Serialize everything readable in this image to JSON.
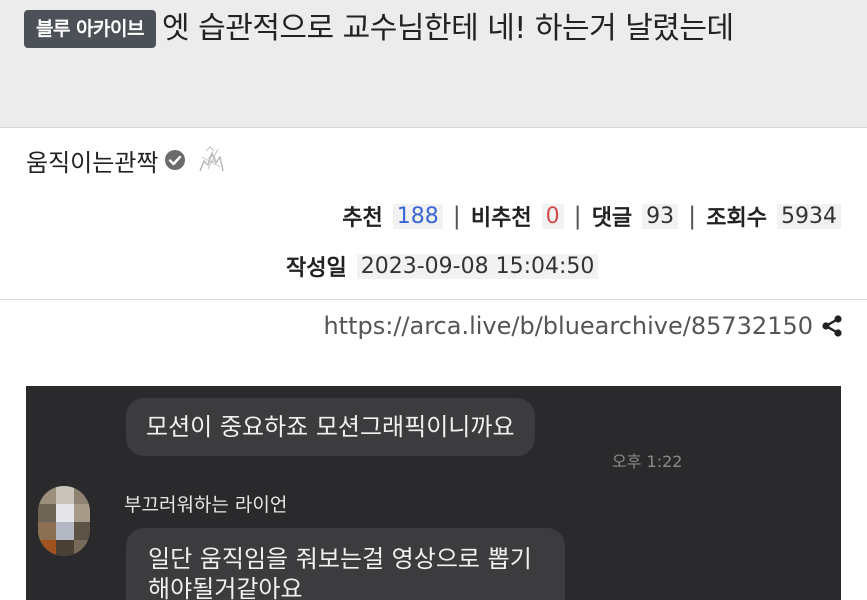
{
  "post": {
    "badge": "블루 아카이브",
    "title": "엣 습관적으로 교수님한테 네! 하는거 날렸는데",
    "author": "움직이는관짝",
    "stats": [
      {
        "label": "추천",
        "value": "188",
        "color": "#3a66d6"
      },
      {
        "label": "비추천",
        "value": "0",
        "color": "#d24b4b"
      },
      {
        "label": "댓글",
        "value": "93",
        "color": "#333333"
      },
      {
        "label": "조회수",
        "value": "5934",
        "color": "#333333"
      }
    ],
    "date_label": "작성일",
    "date_value": "2023-09-08 15:04:50",
    "url": "https://arca.live/b/bluearchive/85732150"
  },
  "chat": {
    "messages": [
      {
        "text": "모션이 중요하죠 모션그래픽이니까요",
        "time": "오후 1:22"
      },
      {
        "sender": "부끄러워하는 라이언",
        "text": "일단 움직임을 줘보는걸 영상으로 뽑기해야될거같아요"
      }
    ]
  },
  "icons": {
    "verified": "verified-check-icon",
    "sticker": "sketch-sticker-icon",
    "share": "share-icon"
  },
  "colors": {
    "title_bg": "#ececec",
    "badge_bg": "#4b5156",
    "chat_bg": "#2a2a2c",
    "bubble_bg": "#3c3c3f",
    "upvote": "#3a66d6",
    "downvote": "#d24b4b"
  }
}
